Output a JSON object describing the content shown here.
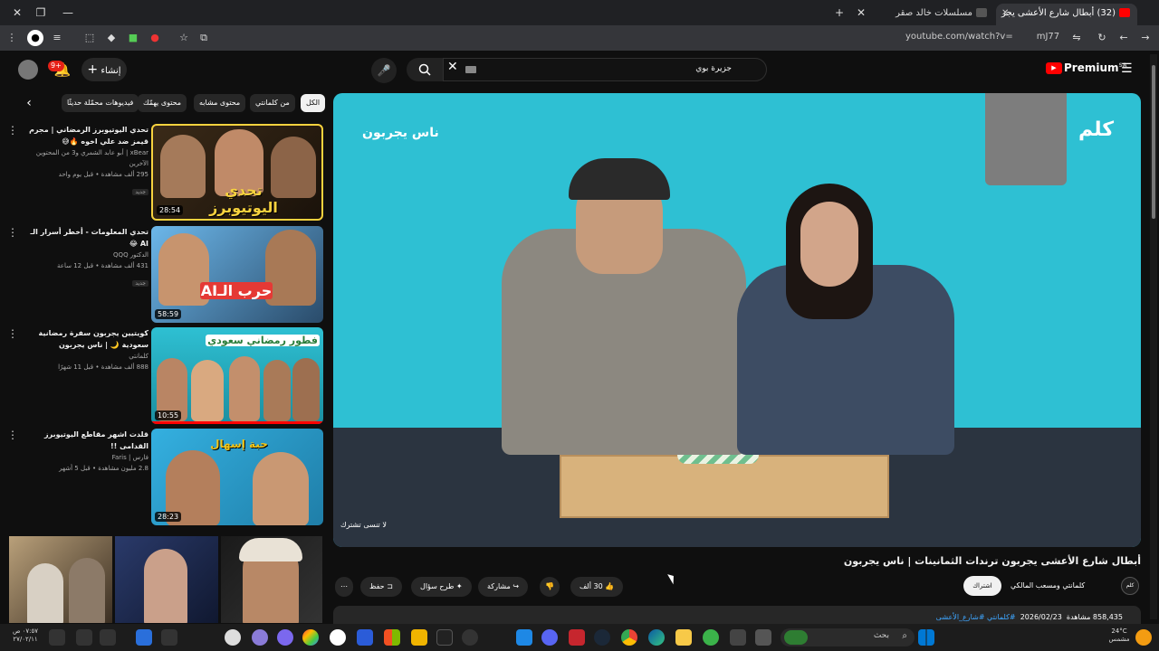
{
  "browser": {
    "tabs": [
      {
        "title": "(32) أبطال شارع الأعشى يجر",
        "active": true
      },
      {
        "title": "مسلسلات خالد صقر",
        "active": false
      }
    ],
    "url": "youtube.com/watch?v=",
    "url_tail": "mJ77s"
  },
  "header": {
    "notification_count": "9+",
    "create_label": "إنشاء",
    "search_value": "جزيرة بوي",
    "logo_text": "Premium",
    "logo_region": "SA"
  },
  "chips": [
    "الكل",
    "من كلمانتي",
    "محتوى مشابه",
    "محتوى يهمّك",
    "فيديوهات محمّلة حديثًا"
  ],
  "recommendations": [
    {
      "title": "تحدي اليوتيوبرز الرمضاني | مجرم قيمز ضد علي اخوه 🔥😅",
      "channel": "xBear | أبو عابد الشمري و3 من المحتوين الآخرين",
      "stats": "295 ألف مشاهدة • قبل يوم واحد",
      "badge": "جديد",
      "duration": "28:54",
      "thumb_text": "تحدي اليوتيوبرز",
      "colors": [
        "#f7d23e",
        "#2b1a0c"
      ]
    },
    {
      "title": "تحدي المعلومات - أخطر أسرار الـ AI 😂",
      "channel": "الدكتور QQQ",
      "stats": "431 ألف مشاهدة • قبل 12 ساعة",
      "badge": "جديد",
      "duration": "58:59",
      "thumb_text": "حرب الـAI",
      "colors": [
        "#5aa9e6",
        "#223344"
      ]
    },
    {
      "title": "كويتيين يجربون سفرة رمضانية سعودية 🌙 | ناس يجربون",
      "channel": "كلمانتي",
      "stats": "888 ألف مشاهدة • قبل 11 شهرًا",
      "badge": "",
      "duration": "10:55",
      "thumb_text": "فطور رمضاني سعودي",
      "colors": [
        "#2ec0d3",
        "#ffffff"
      ]
    },
    {
      "title": "قلدت اشهر مقاطع اليوتيوبرز القدامى !!",
      "channel": "فارس | Faris",
      "stats": "2.8 مليون مشاهدة • قبل 5 أشهر",
      "badge": "",
      "duration": "28:23",
      "thumb_text": "حبة إسهال",
      "colors": [
        "#2aa6d8",
        "#f0c419"
      ]
    }
  ],
  "player": {
    "overlay_label": "ناس يجربون",
    "watermark": "لا تنسى تشترك",
    "brand": "كلم"
  },
  "video": {
    "title": "أبطال شارع الأعشى يجربون ترندات الثمانينات | ناس يجربون",
    "channel": "كلمانتي ومسعب المالكي",
    "channel_avatar": "كلم",
    "subscribe_label": "اشتراك",
    "likes": "30 ألف",
    "share_label": "مشاركة",
    "ask_label": "طرح سؤال",
    "save_label": "حفظ",
    "views": "858,435 مشاهدة",
    "date": "2026/02/23",
    "tags": "#كلمانتي #شارع_الأعشى"
  },
  "taskbar": {
    "search_placeholder": "بحث",
    "weather_temp": "24°C",
    "weather_desc": "مشمس",
    "time": "٠٧:٥٧ ص",
    "date": "٢٧/٠٢/١١"
  }
}
